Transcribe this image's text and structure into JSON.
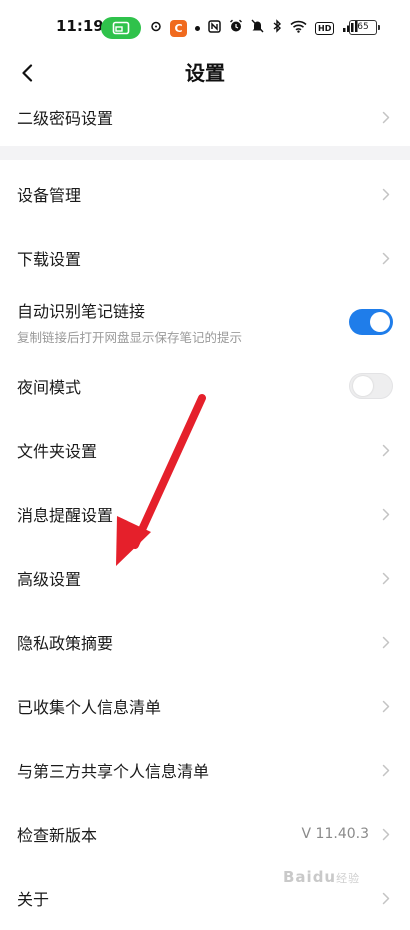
{
  "status_bar": {
    "time": "11:19",
    "app_badge": "C",
    "hd_label": "HD",
    "battery": "65"
  },
  "header": {
    "title": "设置"
  },
  "rows": [
    {
      "label": "二级密码设置"
    },
    {
      "label": "设备管理"
    },
    {
      "label": "下载设置"
    },
    {
      "label": "自动识别笔记链接",
      "subtitle": "复制链接后打开网盘显示保存笔记的提示",
      "toggle": true
    },
    {
      "label": "夜间模式",
      "toggle": false
    },
    {
      "label": "文件夹设置"
    },
    {
      "label": "消息提醒设置"
    },
    {
      "label": "高级设置"
    },
    {
      "label": "隐私政策摘要"
    },
    {
      "label": "已收集个人信息清单"
    },
    {
      "label": "与第三方共享个人信息清单"
    },
    {
      "label": "检查新版本",
      "value": "V 11.40.3"
    },
    {
      "label": "关于"
    }
  ],
  "watermark": {
    "text": "Baidu",
    "sub": "经验"
  },
  "colors": {
    "accent_blue": "#1f7dea",
    "cast_green": "#2fc24b",
    "annotation_red": "#e5202b"
  }
}
